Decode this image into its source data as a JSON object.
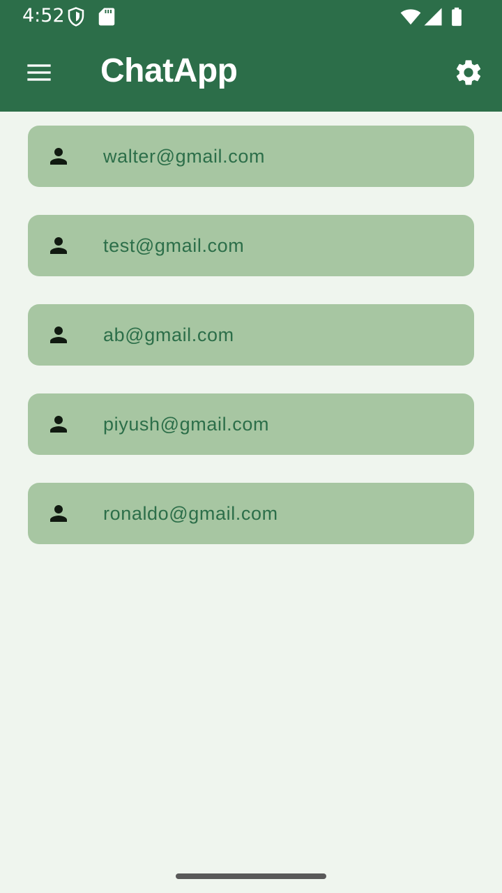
{
  "status_bar": {
    "time": "4:52",
    "icons": [
      "shield-icon",
      "sd-card-icon",
      "wifi-icon",
      "signal-icon",
      "battery-icon"
    ]
  },
  "app_bar": {
    "title": "ChatApp",
    "menu_icon": "menu-icon",
    "settings_icon": "gear-icon"
  },
  "colors": {
    "primary": "#2c6e49",
    "background": "#eff5ee",
    "card": "#a7c6a2",
    "email_text": "#2c6e49",
    "icon": "#000000"
  },
  "users": [
    {
      "email": "walter@gmail.com",
      "icon": "person-icon"
    },
    {
      "email": "test@gmail.com",
      "icon": "person-icon"
    },
    {
      "email": "ab@gmail.com",
      "icon": "person-icon"
    },
    {
      "email": "piyush@gmail.com",
      "icon": "person-icon"
    },
    {
      "email": "ronaldo@gmail.com",
      "icon": "person-icon"
    }
  ]
}
